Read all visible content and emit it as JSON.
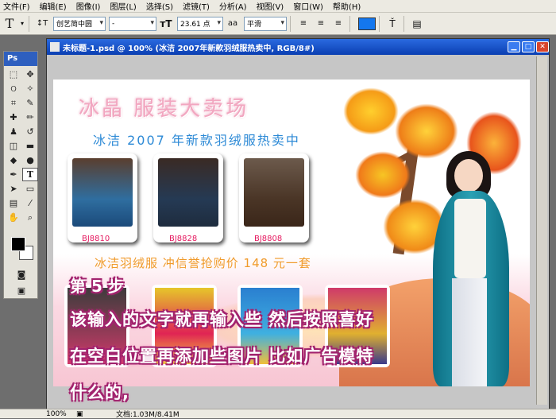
{
  "menu": [
    "文件(F)",
    "编辑(E)",
    "图像(I)",
    "图层(L)",
    "选择(S)",
    "滤镜(T)",
    "分析(A)",
    "视图(V)",
    "窗口(W)",
    "帮助(H)"
  ],
  "options": {
    "font_family": "创艺简中圆",
    "font_style": "-",
    "font_size": "23.61 点",
    "antialias": "平滑"
  },
  "toolbox": {
    "title": "Ps"
  },
  "document": {
    "title": "未标题-1.psd @ 100% (冰洁 2007年新款羽绒服热卖中, RGB/8#)"
  },
  "canvas": {
    "headline": "冰晶 服装大卖场",
    "subhead": "冰洁 2007 年新款羽绒服热卖中",
    "products": [
      "BJ8810",
      "BJ8828",
      "BJ8808"
    ],
    "promo": "冰洁羽绒服 冲信誉抢购价 148 元一套"
  },
  "overlay": {
    "step": "第 5 步",
    "line1": "该输入的文字就再输入些 然后按照喜好",
    "line2": "在空白位置再添加些图片 比如广告模特",
    "line3": "什么的,"
  },
  "status": {
    "zoom": "100%",
    "doc": "文档:1.03M/8.41M"
  }
}
